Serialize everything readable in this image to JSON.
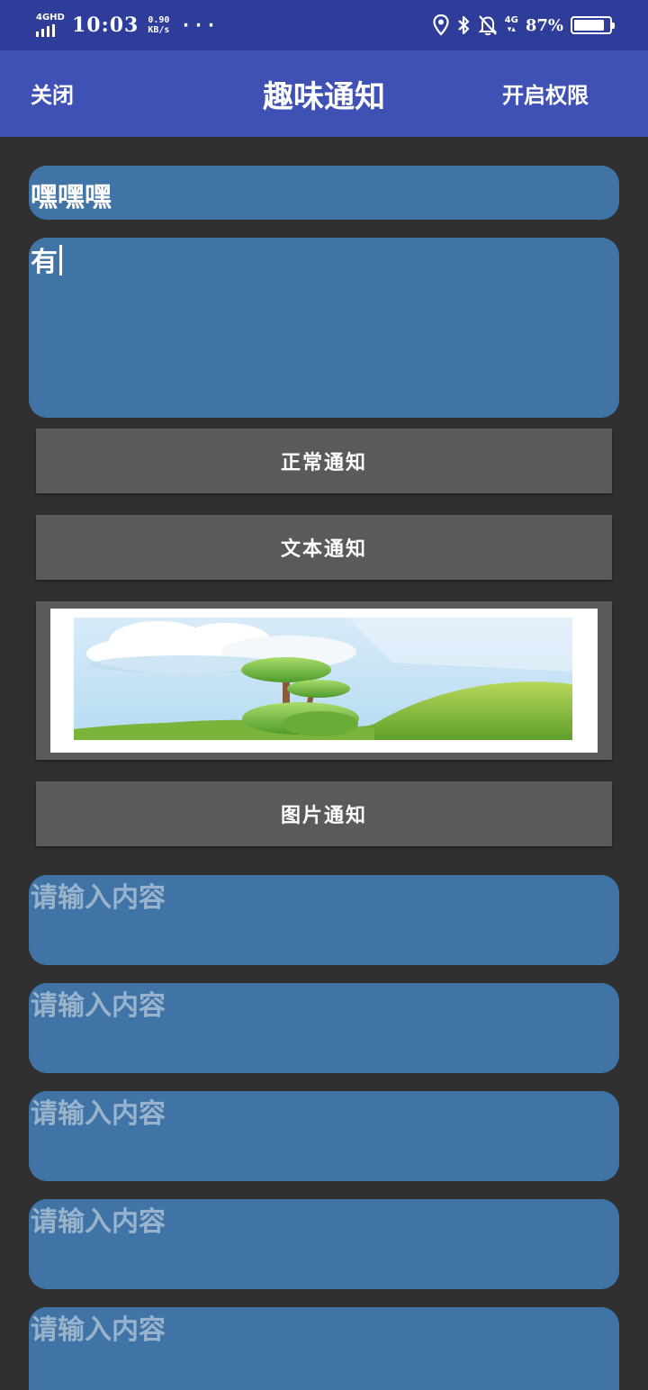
{
  "status_bar": {
    "network_label": "4GHD",
    "time": "10:03",
    "speed_value": "0.90",
    "speed_unit": "KB/s",
    "more": "···",
    "net_right": "4G",
    "battery": "87%",
    "battery_level": 0.87,
    "icons": [
      "location-icon",
      "bluetooth-icon",
      "bell-off-icon",
      "mobile-data-icon",
      "battery-icon"
    ]
  },
  "app_bar": {
    "close_label": "关闭",
    "title": "趣味通知",
    "permission_label": "开启权限"
  },
  "form": {
    "title_value": "嘿嘿嘿",
    "content_value": "有",
    "placeholder": "请输入内容"
  },
  "buttons": {
    "normal": "正常通知",
    "text": "文本通知",
    "image": "图片通知"
  },
  "colors": {
    "status_bar": "#2e3d9a",
    "app_bar": "#3f51b5",
    "background": "#303030",
    "field": "#4074a7",
    "button": "#5a5a5c"
  }
}
